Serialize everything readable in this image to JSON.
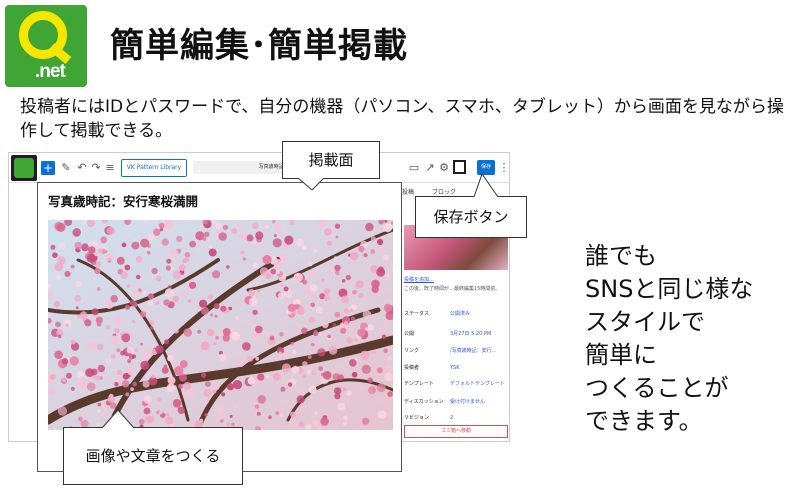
{
  "logo": {
    "text": ".net",
    "letter": "Q",
    "bg_color": "#3fa535",
    "accent_color": "#f5e600"
  },
  "title": "簡単編集･簡単掲載",
  "intro": "投稿者にはIDとパスワードで、自分の機器（パソコン、スマホ、タブレット）から画面を見ながら操作して掲載できる。",
  "editor": {
    "toolbar": {
      "add_icon": "plus-icon",
      "pattern_button": "VK Pattern Library",
      "doc_title": "写真歳時記：安行...",
      "save_button": "保存"
    },
    "sidebar": {
      "tabs": [
        "投稿",
        "ブロック"
      ],
      "featured_link": "投稿を追加…",
      "desc": "この後、既了時間が…最終編集15時間前。",
      "rows": [
        {
          "key": "ステータス",
          "value": "公開済み"
        },
        {
          "key": "公開",
          "value": "3月27日 5:20 PM"
        },
        {
          "key": "リンク",
          "value": "/写真歳時記：安行..."
        },
        {
          "key": "投稿者",
          "value": "YSK"
        },
        {
          "key": "テンプレート",
          "value": "デフォルトテンプレート"
        },
        {
          "key": "ディスカッション",
          "value": "受け付けません"
        },
        {
          "key": "リビジョン",
          "value": "2"
        }
      ],
      "trash": "ゴミ箱へ移動"
    }
  },
  "post": {
    "title": "写真歳時記：安行寒桜満開",
    "photo_icon": "cherry-blossom-photo"
  },
  "callouts": {
    "keisai": "掲載面",
    "save": "保存ボタン",
    "edit": "画像や文章をつくる"
  },
  "side_text": [
    "誰でも",
    "SNSと同じ様な",
    "スタイルで",
    "簡単に",
    "つくることが",
    "できます。"
  ]
}
